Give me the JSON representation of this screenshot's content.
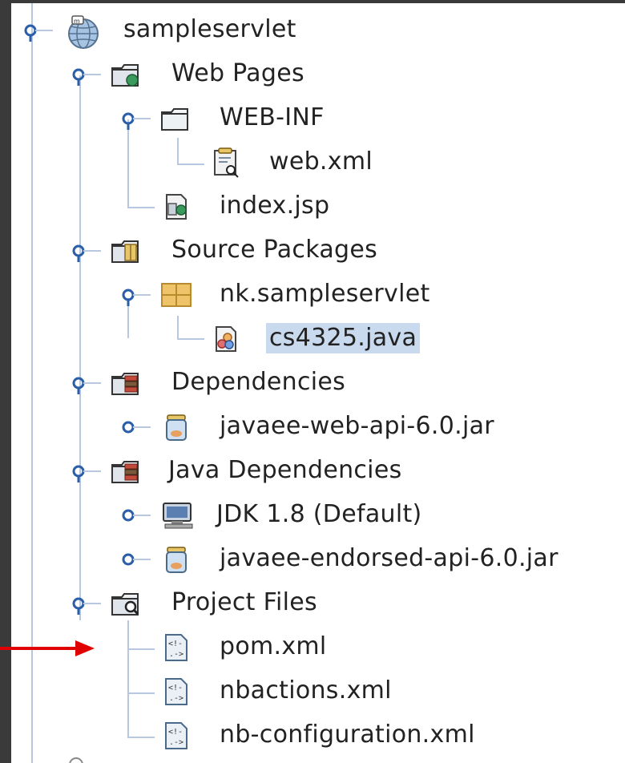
{
  "tree": {
    "root": {
      "label": "sampleservlet",
      "icon": "globe-project-icon"
    },
    "web_pages": {
      "label": "Web Pages",
      "icon": "web-folder-icon"
    },
    "web_inf": {
      "label": "WEB-INF",
      "icon": "folder-icon"
    },
    "web_xml": {
      "label": "web.xml",
      "icon": "xml-config-icon"
    },
    "index_jsp": {
      "label": "index.jsp",
      "icon": "jsp-file-icon"
    },
    "source_packages": {
      "label": "Source Packages",
      "icon": "source-folder-icon"
    },
    "package": {
      "label": "nk.sampleservlet",
      "icon": "package-icon"
    },
    "java_file": {
      "label": "cs4325.java",
      "icon": "java-file-icon",
      "selected": true
    },
    "dependencies": {
      "label": "Dependencies",
      "icon": "library-folder-icon"
    },
    "dep_jar": {
      "label": "javaee-web-api-6.0.jar",
      "icon": "jar-icon"
    },
    "java_dependencies": {
      "label": "Java Dependencies",
      "icon": "library-folder-icon"
    },
    "jdk": {
      "label": "JDK 1.8 (Default)",
      "icon": "jdk-monitor-icon"
    },
    "endorsed_jar": {
      "label": "javaee-endorsed-api-6.0.jar",
      "icon": "jar-icon"
    },
    "project_files": {
      "label": "Project Files",
      "icon": "project-files-folder-icon"
    },
    "pom": {
      "label": "pom.xml",
      "icon": "xml-file-icon"
    },
    "nbactions": {
      "label": "nbactions.xml",
      "icon": "xml-file-icon"
    },
    "nbconfig": {
      "label": "nb-configuration.xml",
      "icon": "xml-file-icon"
    }
  },
  "colors": {
    "selection": "#c9d9ee",
    "annotation_arrow": "#e00000",
    "tree_lines": "#b8c8e0"
  }
}
